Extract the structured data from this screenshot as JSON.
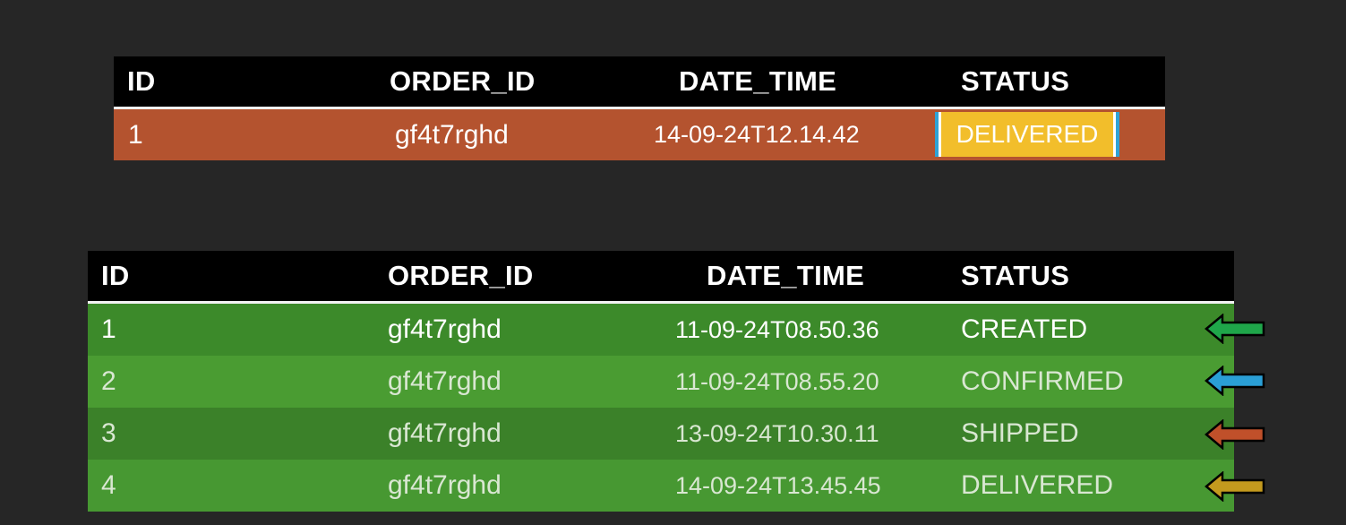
{
  "columns": [
    "ID",
    "ORDER_ID",
    "DATE_TIME",
    "STATUS"
  ],
  "current_table": {
    "row": {
      "id": "1",
      "order_id": "gf4t7rghd",
      "date_time": "14-09-24T12.14.42",
      "status": "DELIVERED"
    }
  },
  "history_table": {
    "rows": [
      {
        "id": "1",
        "order_id": "gf4t7rghd",
        "date_time": "11-09-24T08.50.36",
        "status": "CREATED"
      },
      {
        "id": "2",
        "order_id": "gf4t7rghd",
        "date_time": "11-09-24T08.55.20",
        "status": "CONFIRMED"
      },
      {
        "id": "3",
        "order_id": "gf4t7rghd",
        "date_time": "13-09-24T10.30.11",
        "status": "SHIPPED"
      },
      {
        "id": "4",
        "order_id": "gf4t7rghd",
        "date_time": "14-09-24T13.45.45",
        "status": "DELIVERED"
      }
    ]
  },
  "colors": {
    "background": "#262626",
    "header": "#000000",
    "current_row": "#b4532f",
    "history_rows": [
      "#3c8a2a",
      "#4a9c32",
      "#3b8129",
      "#479832"
    ],
    "badge_fill": "#f2be2b",
    "badge_border": "#2fa3d6",
    "arrows": [
      "#1fa64a",
      "#2a9fd6",
      "#c0502a",
      "#c49a1e"
    ]
  },
  "icons": {
    "arrows": [
      "left-arrow-icon",
      "left-arrow-icon",
      "left-arrow-icon",
      "left-arrow-icon"
    ]
  }
}
